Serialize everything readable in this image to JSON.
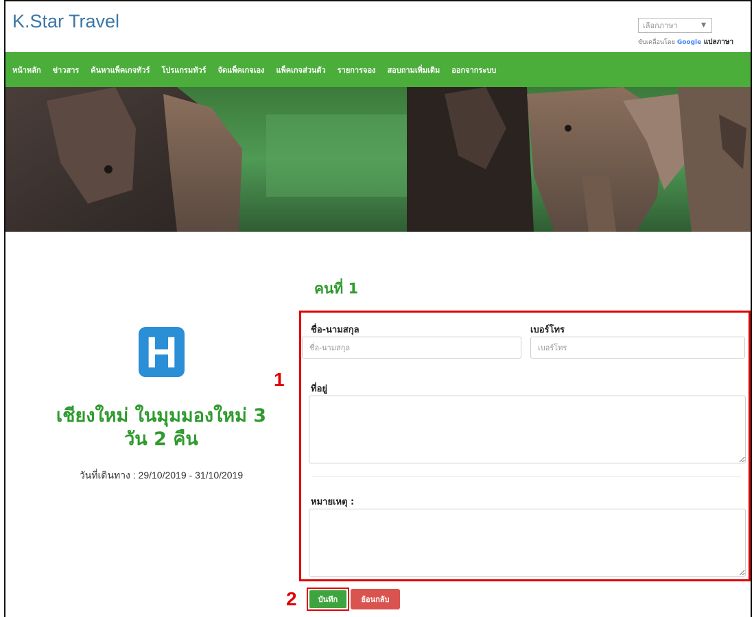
{
  "header": {
    "brand": "K.Star Travel",
    "language_select": {
      "selected": "เลือกภาษา",
      "arrow": "▼"
    },
    "powered_by": {
      "prefix": "ขับเคลื่อนโดย ",
      "google": "Google",
      "translate": " แปลภาษา"
    }
  },
  "nav": {
    "items": [
      "หน้าหลัก",
      "ข่าวสาร",
      "ค้นหาแพ็คเกจทัวร์",
      "โปรแกรมทัวร์",
      "จัดแพ็คเกจเอง",
      "แพ็คเกจส่วนตัว",
      "รายการจอง",
      "สอบถามเพิ่มเติม",
      "ออกจากระบบ"
    ]
  },
  "tour": {
    "logo_letter": "H",
    "title": "เชียงใหม่ ในมุมมองใหม่ 3 วัน 2 คืน",
    "date": "วันที่เดินทาง : 29/10/2019 - 31/10/2019"
  },
  "form": {
    "person_heading": "คนที่ 1",
    "name_label": "ชื่อ-นามสกุล",
    "name_placeholder": "ชื่อ-นามสกุล",
    "phone_label": "เบอร์โทร",
    "phone_placeholder": "เบอร์โทร",
    "address_label": "ที่อยู่",
    "note_label": "หมายเหตุ :"
  },
  "actions": {
    "save_label": "บันทึก",
    "back_label": "ย้อนกลับ"
  },
  "annotations": {
    "step1": "1",
    "step2": "2"
  },
  "colors": {
    "nav_green": "#4bad3a",
    "title_green": "#2f9a2f",
    "brand_blue": "#3b76a8",
    "highlight_red": "#e00000",
    "back_red": "#d9534f"
  }
}
